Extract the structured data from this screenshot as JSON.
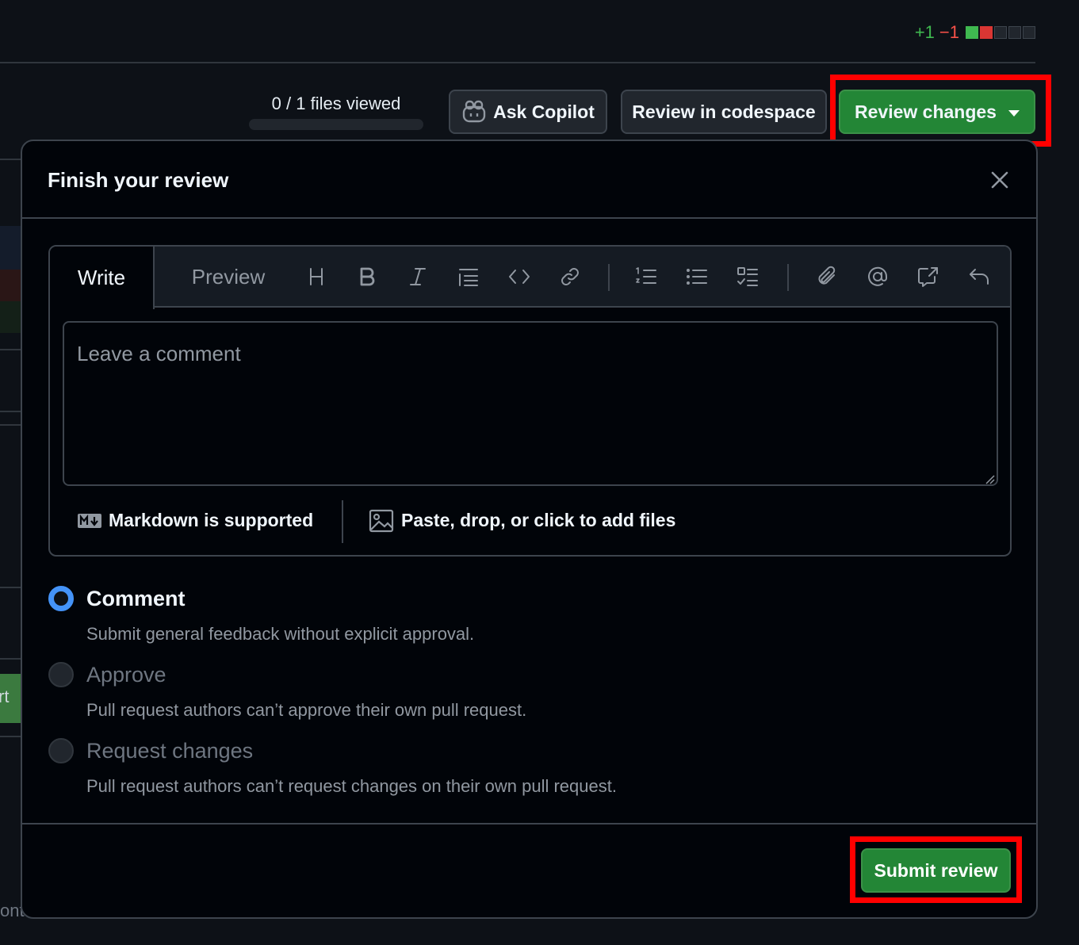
{
  "diffstat": {
    "additions": "+1",
    "deletions": "−1"
  },
  "toolbar": {
    "files_viewed": "0 / 1 files viewed",
    "ask_copilot": "Ask Copilot",
    "review_codespace": "Review in codespace",
    "review_changes": "Review changes"
  },
  "dialog": {
    "title": "Finish your review",
    "tabs": {
      "write": "Write",
      "preview": "Preview"
    },
    "comment_placeholder": "Leave a comment",
    "markdown_note": "Markdown is supported",
    "paste_note": "Paste, drop, or click to add files",
    "options": [
      {
        "label": "Comment",
        "desc": "Submit general feedback without explicit approval.",
        "selected": true
      },
      {
        "label": "Approve",
        "desc": "Pull request authors can’t approve their own pull request.",
        "selected": false
      },
      {
        "label": "Request changes",
        "desc": "Pull request authors can’t request changes on their own pull request.",
        "selected": false
      }
    ],
    "submit": "Submit review"
  },
  "background": {
    "side_fragment": "rt",
    "bottom_fragment": "ont"
  },
  "colors": {
    "accent_green": "#238636",
    "radio_blue": "#4493f8",
    "highlight": "#ff0000"
  },
  "icons": [
    "copilot-icon",
    "close-icon",
    "heading-icon",
    "bold-icon",
    "italic-icon",
    "quote-icon",
    "code-icon",
    "link-icon",
    "ordered-list-icon",
    "unordered-list-icon",
    "task-list-icon",
    "attach-icon",
    "mention-icon",
    "cross-reference-icon",
    "undo-icon",
    "markdown-icon",
    "image-icon"
  ]
}
